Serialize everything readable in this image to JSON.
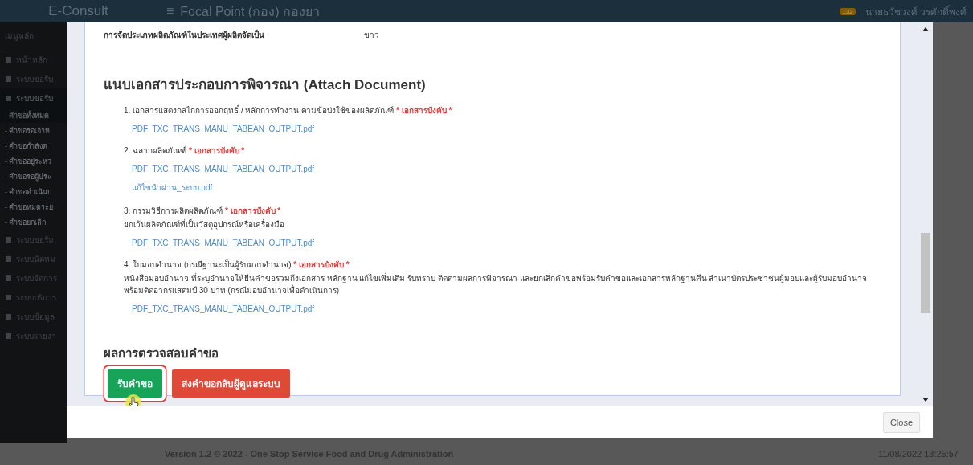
{
  "app": {
    "brand": "E-Consult",
    "menu_icon": "≡",
    "page_title": "Focal Point (กอง) กองยา",
    "notification_count": "132",
    "user": "นายธวัชวงศ์ วรศักดิ์พงศ์"
  },
  "sidebar": {
    "heading": "เมนูหลัก",
    "items": [
      {
        "label": "หน้าหลัก",
        "kind": "main",
        "selected": false
      },
      {
        "label": "ระบบขอรับ",
        "kind": "main",
        "selected": false
      },
      {
        "label": "ระบบขอรับ",
        "kind": "main",
        "selected": true
      },
      {
        "label": "- คำขอทั้งหมด",
        "kind": "sub",
        "selected": true
      },
      {
        "label": "- คำขอรอเจ้าห",
        "kind": "sub",
        "selected": false
      },
      {
        "label": "- คำขอกำลังด",
        "kind": "sub",
        "selected": false
      },
      {
        "label": "- คำขออยู่ระหว",
        "kind": "sub",
        "selected": false
      },
      {
        "label": "- คำขอรอผู้ประ",
        "kind": "sub",
        "selected": false
      },
      {
        "label": "- คำขอดำเนินก",
        "kind": "sub",
        "selected": false
      },
      {
        "label": "- คำขอหมดระย",
        "kind": "sub",
        "selected": false
      },
      {
        "label": "- คำขอยกเลิก",
        "kind": "sub",
        "selected": false
      },
      {
        "label": "ระบบขอรับ",
        "kind": "main",
        "selected": false
      },
      {
        "label": "ระบบนัดหม",
        "kind": "main",
        "selected": false
      },
      {
        "label": "ระบบจัดการ",
        "kind": "main",
        "selected": false
      },
      {
        "label": "ระบบบริการ",
        "kind": "main",
        "selected": false
      },
      {
        "label": "ระบบข้อมูล",
        "kind": "main",
        "selected": false
      },
      {
        "label": "ระบบรายงา",
        "kind": "main",
        "selected": false
      }
    ]
  },
  "footer": {
    "version": "Version 1.2 © 2022 - One Stop Service Food and Drug Administration",
    "timestamp": "11/08/2022 13:25:57"
  },
  "modal": {
    "field": {
      "label": "การจัดประเภทผลิตภัณฑ์ในประเทศผู้ผลิตจัดเป็น",
      "value": "ขาว"
    },
    "section_title": "แนบเอกสารประกอบการพิจารณา (Attach Document)",
    "documents": [
      {
        "label": "1. เอกสารแสดงกลไกการออกฤทธิ์ / หลักการทำงาน ตามข้อบ่งใช้ของผลิตภัณฑ์",
        "required": "* เอกสารบังคับ *",
        "files": [
          "PDF_TXC_TRANS_MANU_TABEAN_OUTPUT.pdf"
        ]
      },
      {
        "label": "2. ฉลากผลิตภัณฑ์",
        "required": "* เอกสารบังคับ *",
        "files": [
          "PDF_TXC_TRANS_MANU_TABEAN_OUTPUT.pdf",
          "แก้ไขนำผ่าน_ระบบ.pdf"
        ]
      },
      {
        "label": "3. กรรมวิธีการผลิตผลิตภัณฑ์",
        "required": "* เอกสารบังคับ *",
        "note": "ยกเว้นผลิตภัณฑ์ที่เป็นวัสดุอุปกรณ์หรือเครื่องมือ",
        "files": [
          "PDF_TXC_TRANS_MANU_TABEAN_OUTPUT.pdf"
        ]
      },
      {
        "label": "4. ใบมอบอำนาจ (กรณีฐานะเป็นผู้รับมอบอำนาจ)",
        "required": "* เอกสารบังคับ *",
        "note": "หนังสือมอบอำนาจ ที่ระบุอำนาจให้ยื่นคำขอรวมถึงเอกสาร หลักฐาน แก้ไขเพิ่มเติม รับทราบ ติดตามผลการพิจารณา และยกเลิกคำขอพร้อมรับคำขอและเอกสารหลักฐานคืน สำเนาบัตรประชาชนผู้มอบและผู้รับมอบอำนาจ พร้อมติดอากรแสตมป์ 30 บาท (กรณีมอบอำนาจเพื่อดำเนินการ)",
        "files": [
          "PDF_TXC_TRANS_MANU_TABEAN_OUTPUT.pdf"
        ]
      }
    ],
    "result_title": "ผลการตรวจสอบคำขอ",
    "actions": [
      {
        "label": "รับคำขอ",
        "kind": "accept",
        "highlighted": true
      },
      {
        "label": "ส่งคำขอกลับผู้ดูแลระบบ",
        "kind": "return",
        "highlighted": false
      }
    ],
    "close": "Close"
  }
}
